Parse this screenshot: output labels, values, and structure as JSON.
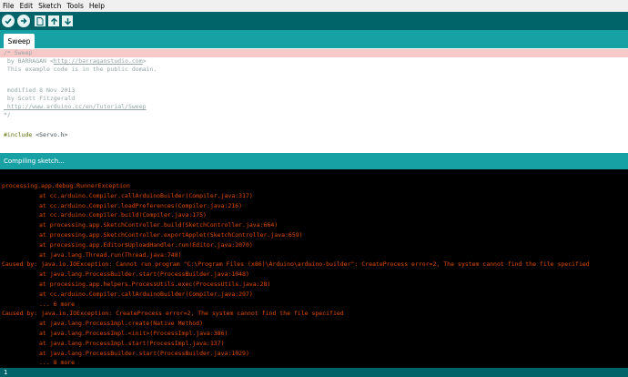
{
  "menu": [
    "File",
    "Edit",
    "Sketch",
    "Tools",
    "Help"
  ],
  "toolbar": {
    "buttons": [
      {
        "name": "verify",
        "icon": "checkmark-icon"
      },
      {
        "name": "upload",
        "icon": "arrow-right-icon"
      },
      {
        "name": "new",
        "icon": "new-file-icon"
      },
      {
        "name": "open",
        "icon": "arrow-up-icon"
      },
      {
        "name": "save",
        "icon": "arrow-down-icon"
      }
    ]
  },
  "tab": {
    "label": "Sweep"
  },
  "editor": {
    "lines": [
      {
        "a": "/* Sweep"
      },
      {
        "a": " by BARRAGAN <",
        "b": "http://barraganstudio.com",
        "c": ">"
      },
      {
        "a": " This example code is in the public domain."
      },
      {
        "a": ""
      },
      {
        "a": " modified 8 Nov 2013"
      },
      {
        "a": " by Scott Fitzgerald"
      },
      {
        "a": "",
        "b": " http://www.arduino.cc/en/Tutorial/Sweep",
        "c": ""
      },
      {
        "a": "*/"
      },
      {
        "a": ""
      },
      {
        "a": "#include",
        "b": " <Servo.h>"
      }
    ]
  },
  "status": {
    "text": "Compiling sketch..."
  },
  "console": {
    "lines": [
      "processing.app.debug.RunnerException",
      "\tat cc.arduino.Compiler.callArduinoBuilder(Compiler.java:317)",
      "\tat cc.arduino.Compiler.loadPreferences(Compiler.java:216)",
      "\tat cc.arduino.Compiler.build(Compiler.java:175)",
      "\tat processing.app.SketchController.build(SketchController.java:664)",
      "\tat processing.app.SketchController.exportApplet(SketchController.java:659)",
      "\tat processing.app.Editor$UploadHandler.run(Editor.java:2070)",
      "\tat java.lang.Thread.run(Thread.java:748)",
      "Caused by: java.io.IOException: Cannot run program \"C:\\Program Files (x86)\\Arduino\\arduino-builder\": CreateProcess error=2, The system cannot find the file specified",
      "\tat java.lang.ProcessBuilder.start(ProcessBuilder.java:1048)",
      "\tat processing.app.helpers.ProcessUtils.exec(ProcessUtils.java:28)",
      "\tat cc.arduino.Compiler.callArduinoBuilder(Compiler.java:297)",
      "\t... 6 more",
      "Caused by: java.io.IOException: CreateProcess error=2, The system cannot find the file specified",
      "\tat java.lang.ProcessImpl.create(Native Method)",
      "\tat java.lang.ProcessImpl.<init>(ProcessImpl.java:386)",
      "\tat java.lang.ProcessImpl.start(ProcessImpl.java:137)",
      "\tat java.lang.ProcessBuilder.start(ProcessBuilder.java:1029)",
      "\t... 8 more"
    ]
  },
  "footer": {
    "line_number": "1"
  }
}
